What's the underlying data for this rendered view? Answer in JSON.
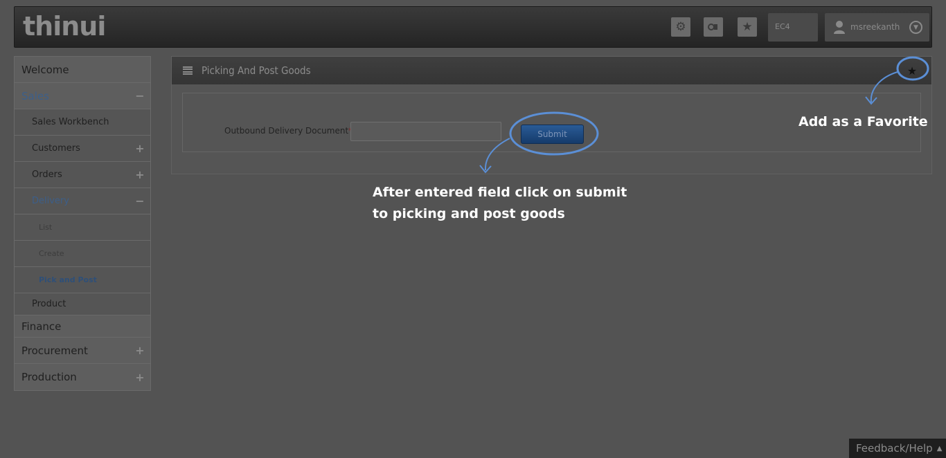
{
  "header": {
    "logo": "thinui",
    "settings_icon": "gear-icon",
    "network_icon": "network-icon",
    "favorites_icon": "star-icon",
    "environment": "EC4",
    "username": "msreekanth"
  },
  "sidebar": {
    "items": [
      {
        "label": "Welcome"
      },
      {
        "label": "Sales",
        "sign": "−"
      },
      {
        "label": "Sales Workbench"
      },
      {
        "label": "Customers",
        "sign": "+"
      },
      {
        "label": "Orders",
        "sign": "+"
      },
      {
        "label": "Delivery",
        "sign": "−"
      },
      {
        "label": "List"
      },
      {
        "label": "Create"
      },
      {
        "label": "Pick and Post"
      },
      {
        "label": "Product"
      },
      {
        "label": "Finance"
      },
      {
        "label": "Procurement",
        "sign": "+"
      },
      {
        "label": "Production",
        "sign": "+"
      }
    ]
  },
  "main": {
    "title": "Picking And Post Goods",
    "field_label": "Outbound Delivery Document",
    "required_mark": "*",
    "label_colon": ":",
    "field_value": "",
    "submit_label": "Submit"
  },
  "annotations": {
    "favorite": "Add as a Favorite",
    "submit_line1": "After entered field click on submit",
    "submit_line2": "to picking and post goods"
  },
  "footer": {
    "feedback": "Feedback/Help"
  },
  "colors": {
    "accent": "#3c5f8a",
    "annotation_circle": "#5b8fd6",
    "submit_button": "#1f4a80"
  }
}
